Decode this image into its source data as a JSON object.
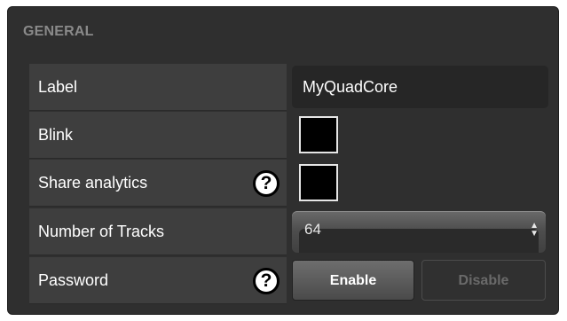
{
  "section": {
    "title": "GENERAL"
  },
  "rows": {
    "label": {
      "name": "Label",
      "value": "MyQuadCore"
    },
    "blink": {
      "name": "Blink",
      "checked": false
    },
    "share_analytics": {
      "name": "Share analytics",
      "help": "?",
      "checked": false
    },
    "number_of_tracks": {
      "name": "Number of Tracks",
      "selected": "64",
      "arrows": "▲\n▼"
    },
    "password": {
      "name": "Password",
      "help": "?",
      "enable_label": "Enable",
      "disable_label": "Disable"
    }
  },
  "colors": {
    "panel_bg": "#2f2f2f",
    "row_bg": "#3e3e3e",
    "field_bg": "#262626",
    "title": "#8a8a8a",
    "text": "#ffffff"
  }
}
